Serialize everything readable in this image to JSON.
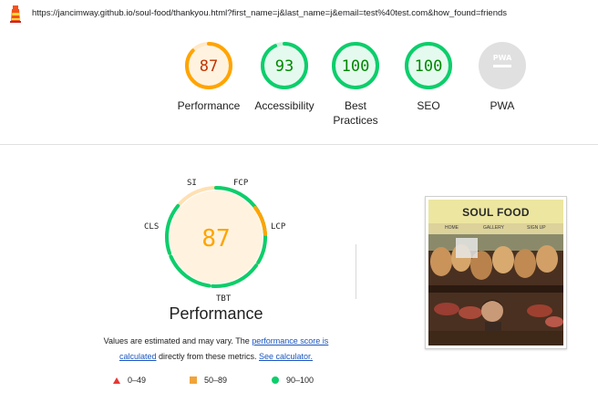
{
  "url": "https://jancimway.github.io/soul-food/thankyou.html?first_name=j&last_name=j&email=test%40test.com&how_found=friends",
  "colors": {
    "pass": "#0cce6b",
    "pass_text": "#008800",
    "average": "#ffa400",
    "average_text": "#c33300",
    "fail": "#ff4e42",
    "pwa_grey": "#e0e0e0"
  },
  "gauges": [
    {
      "score": "87",
      "label": "Performance",
      "level": 0.87,
      "status": "average"
    },
    {
      "score": "93",
      "label": "Accessibility",
      "level": 0.93,
      "status": "pass"
    },
    {
      "score": "100",
      "label": "Best Practices",
      "level": 1.0,
      "status": "pass"
    },
    {
      "score": "100",
      "label": "SEO",
      "level": 1.0,
      "status": "pass"
    },
    {
      "score": "",
      "label": "PWA",
      "badge": "PWA",
      "status": "na"
    }
  ],
  "performance": {
    "score": "87",
    "title": "Performance",
    "metrics": [
      "SI",
      "FCP",
      "LCP",
      "TBT",
      "CLS"
    ],
    "note_pre": "Values are estimated and may vary. The ",
    "note_link1": "performance score is calculated",
    "note_mid": " directly from these metrics. ",
    "note_link2": "See calculator."
  },
  "legend": {
    "fail": "0–49",
    "average": "50–89",
    "pass": "90–100"
  },
  "screenshot": {
    "title": "SOUL FOOD",
    "nav": [
      "HOME",
      "GALLERY",
      "SIGN UP"
    ]
  }
}
